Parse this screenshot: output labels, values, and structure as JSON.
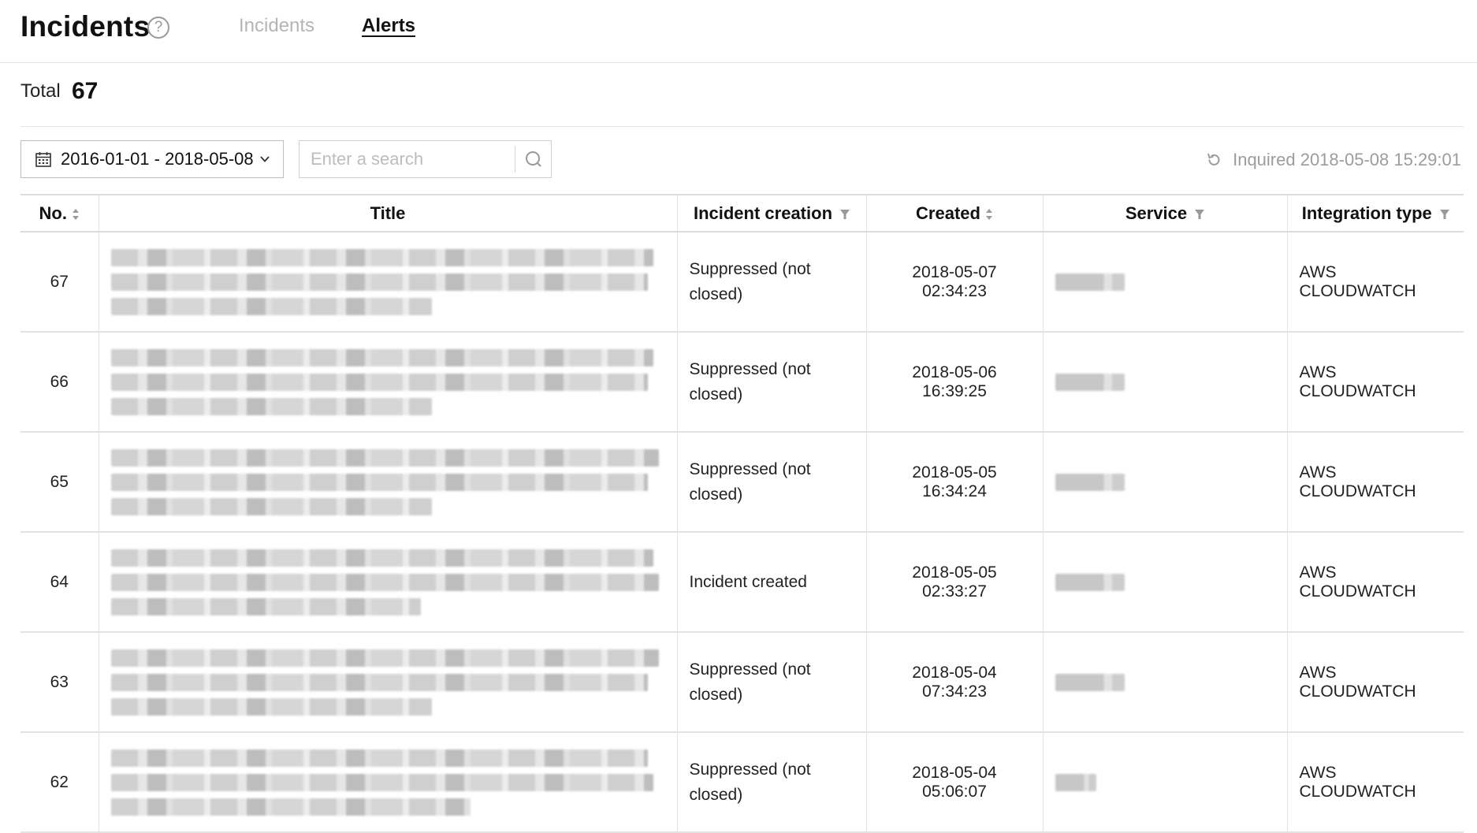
{
  "header": {
    "title": "Incidents",
    "help_icon": "?",
    "tabs": [
      {
        "label": "Incidents",
        "active": false
      },
      {
        "label": "Alerts",
        "active": true
      }
    ]
  },
  "summary": {
    "total_label": "Total",
    "total_count": "67"
  },
  "toolbar": {
    "date_range": "2016-01-01 - 2018-05-08",
    "search_placeholder": "Enter a search",
    "search_value": "",
    "inquired": "Inquired 2018-05-08 15:29:01"
  },
  "table": {
    "columns": [
      "No.",
      "Title",
      "Incident creation",
      "Created",
      "Service",
      "Integration type"
    ],
    "rows": [
      {
        "no": "67",
        "incident_creation": "Suppressed (not closed)",
        "created": "2018-05-07 02:34:23",
        "integration_type": "AWS CLOUDWATCH"
      },
      {
        "no": "66",
        "incident_creation": "Suppressed (not closed)",
        "created": "2018-05-06 16:39:25",
        "integration_type": "AWS CLOUDWATCH"
      },
      {
        "no": "65",
        "incident_creation": "Suppressed (not closed)",
        "created": "2018-05-05 16:34:24",
        "integration_type": "AWS CLOUDWATCH"
      },
      {
        "no": "64",
        "incident_creation": "Incident created",
        "created": "2018-05-05 02:33:27",
        "integration_type": "AWS CLOUDWATCH"
      },
      {
        "no": "63",
        "incident_creation": "Suppressed (not closed)",
        "created": "2018-05-04 07:34:23",
        "integration_type": "AWS CLOUDWATCH"
      },
      {
        "no": "62",
        "incident_creation": "Suppressed (not closed)",
        "created": "2018-05-04 05:06:07",
        "integration_type": "AWS CLOUDWATCH"
      }
    ]
  },
  "icons": {
    "help": "help-icon",
    "calendar": "calendar-icon",
    "chevron": "chevron-down-icon",
    "search": "search-icon",
    "refresh": "refresh-icon",
    "sort": "sort-icon",
    "filter": "filter-icon"
  },
  "colors": {
    "text": "#111111",
    "muted": "#9c9c9c",
    "border": "#e3e3e3",
    "tab_inactive": "#b5b5b5"
  }
}
